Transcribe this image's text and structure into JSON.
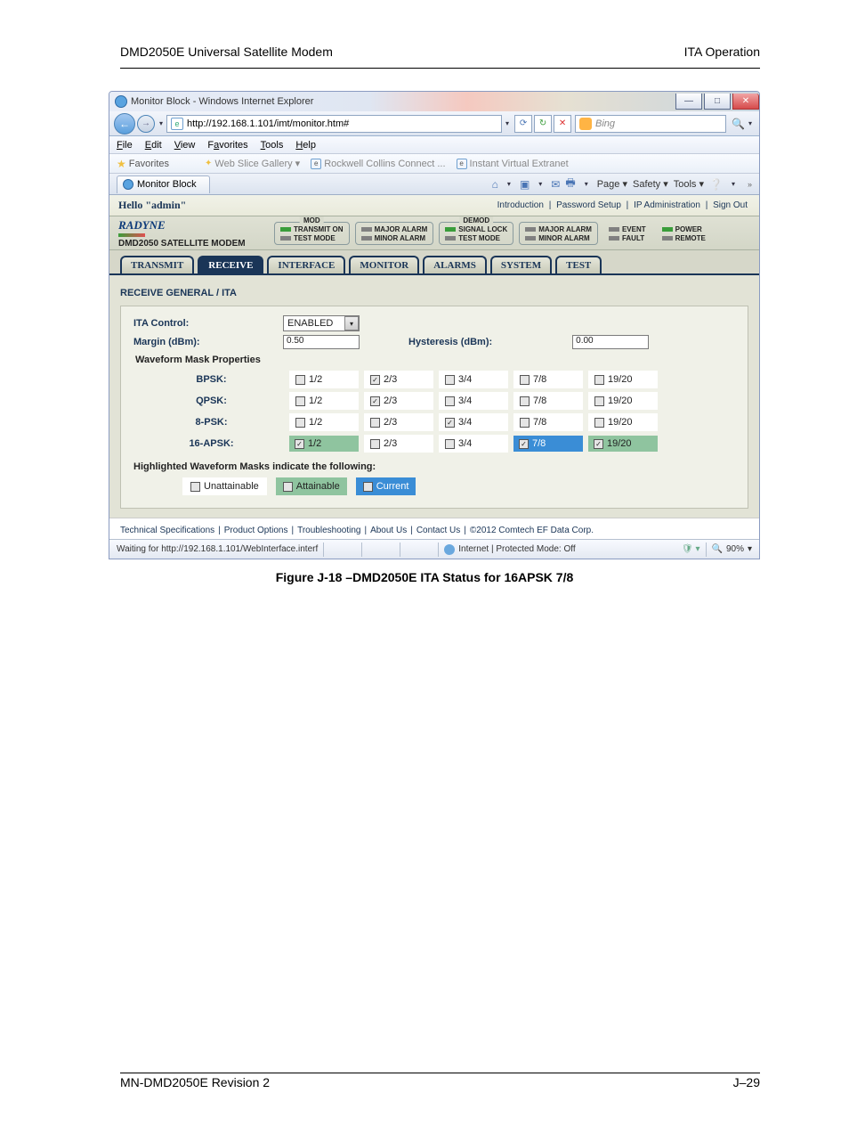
{
  "doc": {
    "header_left": "DMD2050E Universal Satellite Modem",
    "header_right": "ITA Operation",
    "footer_left": "MN-DMD2050E   Revision 2",
    "footer_right": "J–29",
    "caption": "Figure J-18 –DMD2050E ITA Status for 16APSK 7/8"
  },
  "window": {
    "title": "Monitor Block - Windows Internet Explorer",
    "url": "http://192.168.1.101/imt/monitor.htm#",
    "search_placeholder": "Bing",
    "tab_label": "Monitor Block",
    "status_left": "Waiting for http://192.168.1.101/WebInterface.interf",
    "status_zone": "Internet | Protected Mode: Off",
    "zoom": "90%"
  },
  "menus": [
    "File",
    "Edit",
    "View",
    "Favorites",
    "Tools",
    "Help"
  ],
  "favbar": {
    "label": "Favorites",
    "items": [
      "Web Slice Gallery ▾",
      "Rockwell Collins Connect ...",
      "Instant Virtual Extranet"
    ]
  },
  "toolbar_right": [
    "Page ▾",
    "Safety ▾",
    "Tools ▾"
  ],
  "app": {
    "hello": "Hello \"admin\"",
    "nav": [
      "Introduction",
      "Password Setup",
      "IP Administration",
      "Sign Out"
    ],
    "brand": "RADYNE",
    "brand_sub": "DMD2050 Satellite Modem",
    "groups": {
      "mod": {
        "title": "MOD",
        "rows": [
          {
            "led": "g",
            "label": "TRANSMIT ON"
          },
          {
            "led": "gr",
            "label": "TEST MODE"
          }
        ]
      },
      "moda": {
        "rows": [
          {
            "led": "gr",
            "label": "MAJOR ALARM"
          },
          {
            "led": "gr",
            "label": "MINOR ALARM"
          }
        ]
      },
      "demod": {
        "title": "DEMOD",
        "rows": [
          {
            "led": "g",
            "label": "SIGNAL LOCK"
          },
          {
            "led": "gr",
            "label": "TEST MODE"
          }
        ]
      },
      "demoda": {
        "rows": [
          {
            "led": "gr",
            "label": "MAJOR ALARM"
          },
          {
            "led": "gr",
            "label": "MINOR ALARM"
          }
        ]
      },
      "sys": {
        "rows": [
          {
            "led": "gr",
            "label": "EVENT"
          },
          {
            "led": "gr",
            "label": "FAULT"
          }
        ]
      },
      "sys2": {
        "rows": [
          {
            "led": "g",
            "label": "POWER"
          },
          {
            "led": "gr",
            "label": "REMOTE"
          }
        ]
      }
    },
    "tabs": [
      "TRANSMIT",
      "RECEIVE",
      "INTERFACE",
      "MONITOR",
      "ALARMS",
      "SYSTEM",
      "TEST"
    ],
    "active_tab": "RECEIVE",
    "panel_title": "RECEIVE GENERAL / ITA",
    "ita_control_label": "ITA Control:",
    "ita_control_value": "ENABLED",
    "margin_label": "Margin (dBm):",
    "margin_value": "0.50",
    "hysteresis_label": "Hysteresis (dBm):",
    "hysteresis_value": "0.00",
    "waveform_header": "Waveform Mask Properties",
    "modulations": [
      "BPSK:",
      "QPSK:",
      "8-PSK:",
      "16-APSK:"
    ],
    "rates": [
      "1/2",
      "2/3",
      "3/4",
      "7/8",
      "19/20"
    ],
    "matrix": [
      [
        {
          "c": "w",
          "chk": false
        },
        {
          "c": "w",
          "chk": true
        },
        {
          "c": "w",
          "chk": false
        },
        {
          "c": "w",
          "chk": false
        },
        {
          "c": "w",
          "chk": false
        }
      ],
      [
        {
          "c": "w",
          "chk": false
        },
        {
          "c": "w",
          "chk": true
        },
        {
          "c": "w",
          "chk": false
        },
        {
          "c": "w",
          "chk": false
        },
        {
          "c": "w",
          "chk": false
        }
      ],
      [
        {
          "c": "w",
          "chk": false
        },
        {
          "c": "w",
          "chk": false
        },
        {
          "c": "w",
          "chk": true
        },
        {
          "c": "w",
          "chk": false
        },
        {
          "c": "w",
          "chk": false
        }
      ],
      [
        {
          "c": "g",
          "chk": true
        },
        {
          "c": "w",
          "chk": false
        },
        {
          "c": "w",
          "chk": false
        },
        {
          "c": "b",
          "chk": true
        },
        {
          "c": "g",
          "chk": true
        }
      ]
    ],
    "legend_header": "Highlighted Waveform Masks indicate the following:",
    "legend": [
      {
        "label": "Unattainable",
        "cls": "w"
      },
      {
        "label": "Attainable",
        "cls": "g"
      },
      {
        "label": "Current",
        "cls": "b"
      }
    ],
    "footer_links": [
      "Technical Specifications",
      "Product Options",
      "Troubleshooting",
      "About Us",
      "Contact Us",
      "©2012 Comtech EF Data Corp."
    ]
  }
}
